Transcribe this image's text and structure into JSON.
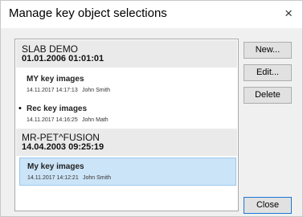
{
  "window": {
    "title": "Manage key object selections",
    "close_glyph": "×"
  },
  "groups": [
    {
      "name": "SLAB DEMO",
      "date": "01.01.2006 01:01:01",
      "items": [
        {
          "name": "MY key images",
          "timestamp": "14.11.2017 14:17:13",
          "author": "John Smith",
          "bullet": "",
          "selected": false
        },
        {
          "name": "Rec key images",
          "timestamp": "14.11.2017 14:16:25",
          "author": "John Math",
          "bullet": "•",
          "selected": false
        }
      ]
    },
    {
      "name": "MR-PET^FUSION",
      "date": "14.04.2003 09:25:19",
      "items": [
        {
          "name": "My key images",
          "timestamp": "14.11.2017 14:12:21",
          "author": "John Smith",
          "bullet": "",
          "selected": true
        }
      ]
    }
  ],
  "buttons": {
    "new": "New...",
    "edit": "Edit...",
    "delete": "Delete",
    "close": "Close"
  },
  "colors": {
    "selection_background": "#cce4f7",
    "selection_border": "#99c9ef",
    "group_header_background": "#eaeaea"
  }
}
